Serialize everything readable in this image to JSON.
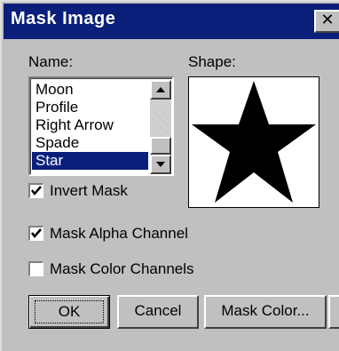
{
  "window": {
    "title": "Mask Image",
    "close_glyph": "✕"
  },
  "name_section": {
    "label": "Name:",
    "items": [
      "Moon",
      "Profile",
      "Right Arrow",
      "Spade",
      "Star"
    ],
    "selected": "Star"
  },
  "shape_section": {
    "label": "Shape:",
    "preview_icon": "star-icon"
  },
  "options": {
    "invert_mask": {
      "label": "Invert Mask",
      "checked": true
    },
    "mask_alpha": {
      "label": "Mask Alpha Channel",
      "checked": true
    },
    "mask_color_channels": {
      "label": "Mask Color Channels",
      "checked": false
    }
  },
  "buttons": {
    "ok": "OK",
    "cancel": "Cancel",
    "mask_color": "Mask Color..."
  },
  "colors": {
    "title_bar": "#0a1f7a",
    "selection": "#0a1f7a",
    "face": "#c0c0c0"
  }
}
